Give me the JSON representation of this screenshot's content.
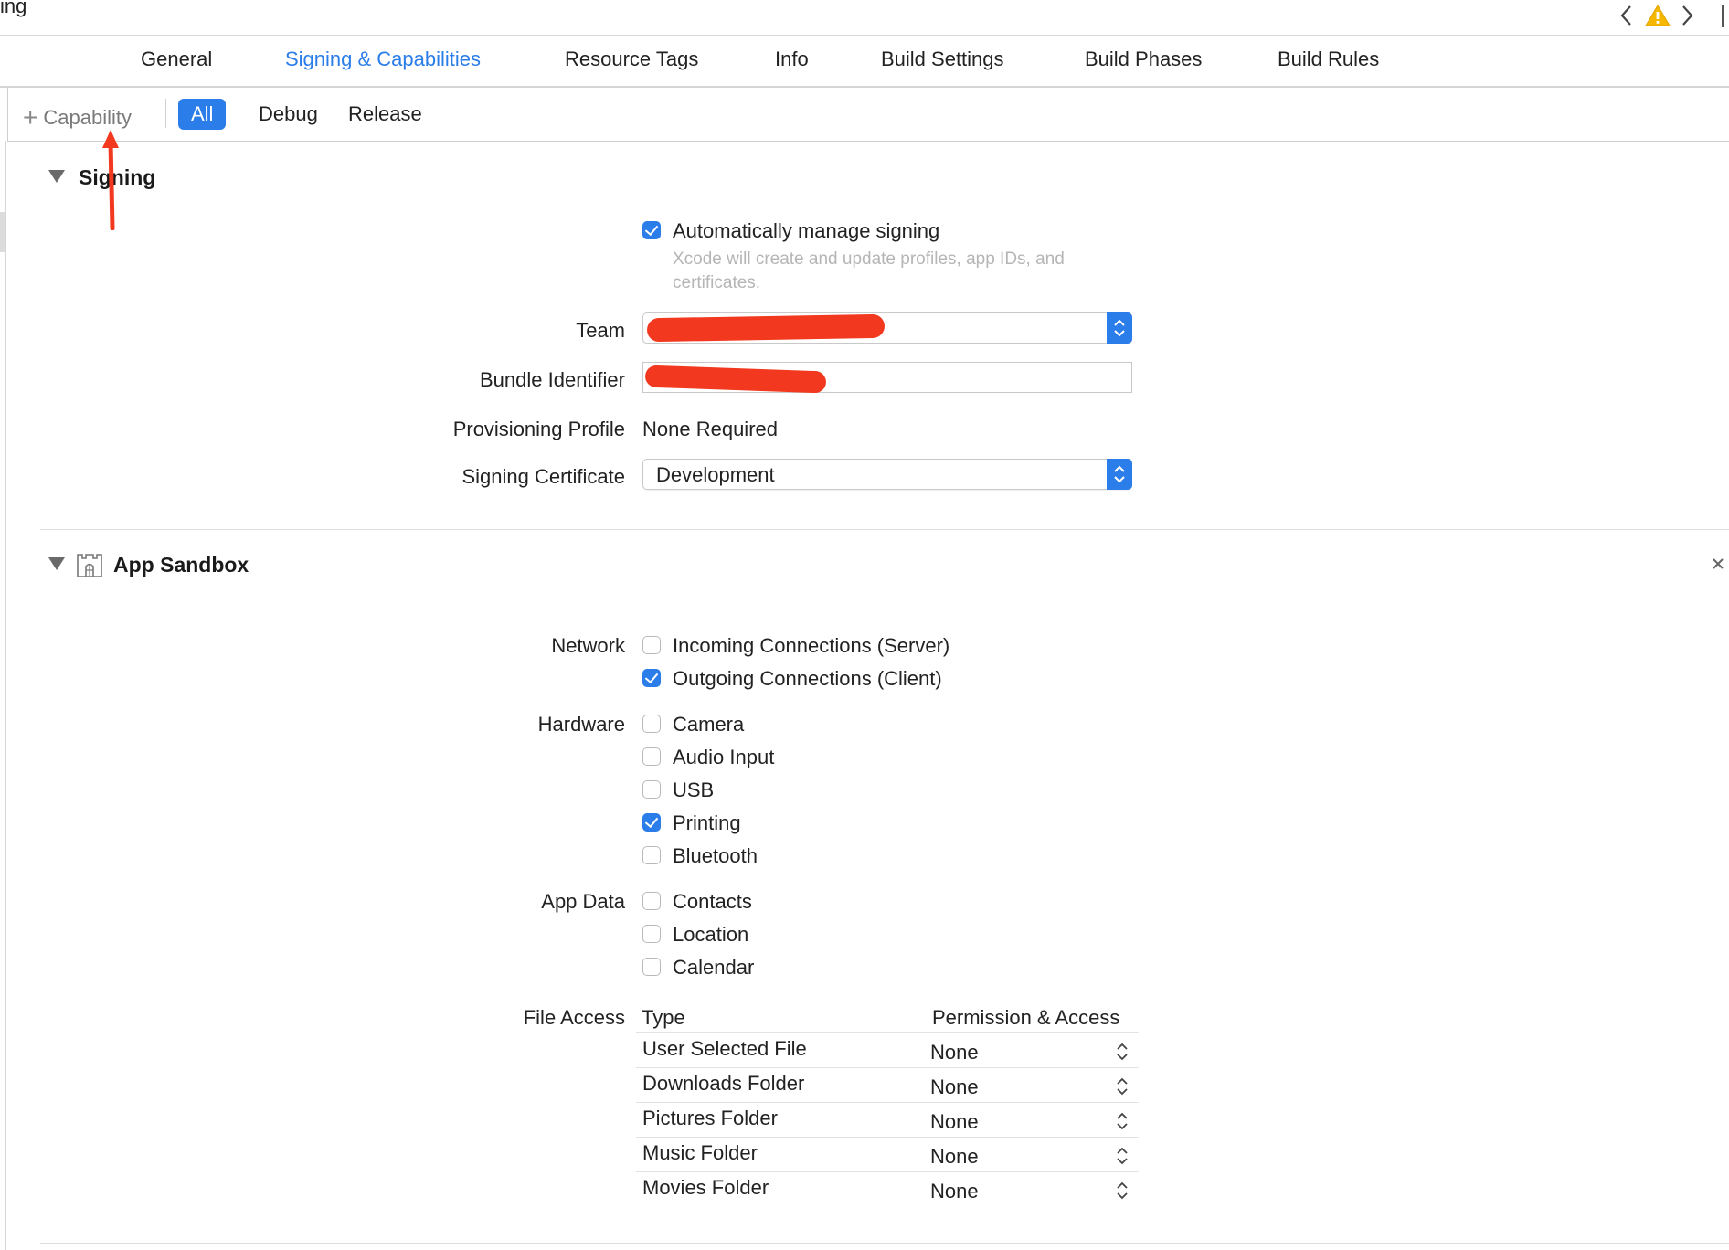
{
  "window": {
    "breadcrumb_tail": "ing"
  },
  "tabs": [
    {
      "label": "General"
    },
    {
      "label": "Signing & Capabilities"
    },
    {
      "label": "Resource Tags"
    },
    {
      "label": "Info"
    },
    {
      "label": "Build Settings"
    },
    {
      "label": "Build Phases"
    },
    {
      "label": "Build Rules"
    }
  ],
  "filter": {
    "add_capability": "Capability",
    "segments": [
      "All",
      "Debug",
      "Release"
    ],
    "selected": "All"
  },
  "signing": {
    "title": "Signing",
    "auto_manage": {
      "label": "Automatically manage signing",
      "checked": true,
      "hint": "Xcode will create and update profiles, app IDs, and certificates."
    },
    "team_label": "Team",
    "bundle_label": "Bundle Identifier",
    "provisioning_label": "Provisioning Profile",
    "provisioning_value": "None Required",
    "certificate_label": "Signing Certificate",
    "certificate_value": "Development"
  },
  "sandbox": {
    "title": "App Sandbox",
    "network_label": "Network",
    "network": [
      {
        "label": "Incoming Connections (Server)",
        "checked": false
      },
      {
        "label": "Outgoing Connections (Client)",
        "checked": true
      }
    ],
    "hardware_label": "Hardware",
    "hardware": [
      {
        "label": "Camera",
        "checked": false
      },
      {
        "label": "Audio Input",
        "checked": false
      },
      {
        "label": "USB",
        "checked": false
      },
      {
        "label": "Printing",
        "checked": true
      },
      {
        "label": "Bluetooth",
        "checked": false
      }
    ],
    "appdata_label": "App Data",
    "appdata": [
      {
        "label": "Contacts",
        "checked": false
      },
      {
        "label": "Location",
        "checked": false
      },
      {
        "label": "Calendar",
        "checked": false
      }
    ],
    "file_access_label": "File Access",
    "file_table": {
      "col_type": "Type",
      "col_perm": "Permission & Access",
      "rows": [
        {
          "type": "User Selected File",
          "perm": "None"
        },
        {
          "type": "Downloads Folder",
          "perm": "None"
        },
        {
          "type": "Pictures Folder",
          "perm": "None"
        },
        {
          "type": "Music Folder",
          "perm": "None"
        },
        {
          "type": "Movies Folder",
          "perm": "None"
        }
      ]
    }
  },
  "colors": {
    "accent": "#2b7de9",
    "annotation": "#f2381e",
    "warning": "#f5b700"
  },
  "icons": [
    "chevron-left-icon",
    "warning-icon",
    "chevron-right-icon",
    "plus-icon",
    "disclosure-triangle-icon",
    "sandbox-castle-icon",
    "close-icon",
    "stepper-icon",
    "checkmark-icon"
  ]
}
